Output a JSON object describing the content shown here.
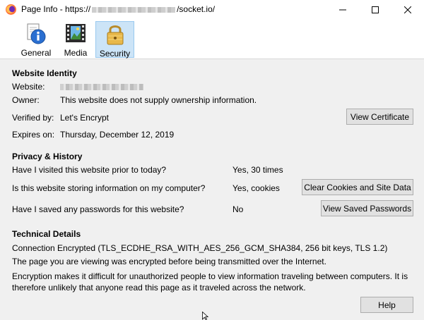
{
  "window": {
    "title_prefix": "Page Info - https://",
    "title_suffix": "/socket.io/",
    "controls": {
      "minimize": "minimize-icon",
      "maximize": "maximize-icon",
      "close": "close-icon"
    }
  },
  "tabs": [
    {
      "label": "General",
      "icon": "info-icon"
    },
    {
      "label": "Media",
      "icon": "media-icon"
    },
    {
      "label": "Security",
      "icon": "lock-icon",
      "selected": true
    }
  ],
  "identity": {
    "heading": "Website Identity",
    "website_label": "Website:",
    "owner_label": "Owner:",
    "owner_value": "This website does not supply ownership information.",
    "verified_label": "Verified by:",
    "verified_value": "Let's Encrypt",
    "expires_label": "Expires on:",
    "expires_value": "Thursday, December 12, 2019",
    "view_certificate": "View Certificate"
  },
  "privacy": {
    "heading": "Privacy & History",
    "q1": "Have I visited this website prior to today?",
    "a1": "Yes, 30 times",
    "q2": "Is this website storing information on my computer?",
    "a2": "Yes, cookies",
    "clear_button": "Clear Cookies and Site Data",
    "q3": "Have I saved any passwords for this website?",
    "a3": "No",
    "passwords_button": "View Saved Passwords"
  },
  "technical": {
    "heading": "Technical Details",
    "connection": "Connection Encrypted (TLS_ECDHE_RSA_WITH_AES_256_GCM_SHA384, 256 bit keys, TLS 1.2)",
    "line2": "The page you are viewing was encrypted before being transmitted over the Internet.",
    "line3a": "Encryption makes it difficult for unauthorized people to view information traveling between computers. It is",
    "line3b": "therefore unlikely that anyone read this page as it traveled across the network."
  },
  "help_button": "Help",
  "colors": {
    "selected_tab_bg": "#cce4f7",
    "selected_tab_border": "#99c9ef",
    "button_bg": "#e1e1e1"
  }
}
